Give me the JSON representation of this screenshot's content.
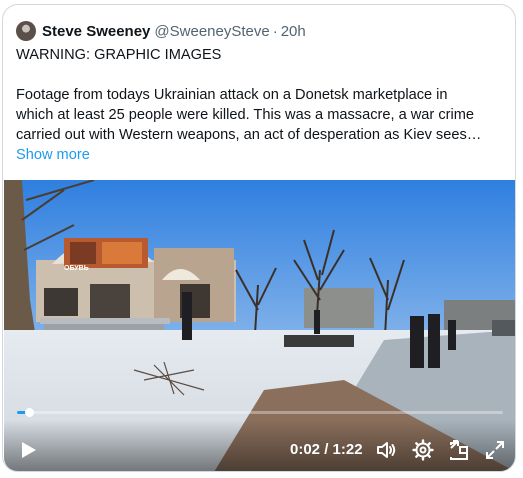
{
  "tweet": {
    "author_name": "Steve Sweeney",
    "handle": "@SweeneySteve",
    "separator": "·",
    "time": "20h",
    "warning": "WARNING: GRAPHIC IMAGES",
    "body_lines": [
      "Footage from todays Ukrainian attack on a Donetsk marketplace in",
      "which at least 25 people were killed. This was a massacre, a war crime",
      "carried out with Western weapons, an act of desperation as Kiev sees…"
    ],
    "show_more": "Show more"
  },
  "video": {
    "current_time": "0:02",
    "duration": "1:22",
    "time_separator": "/",
    "progress_fraction": 0.024,
    "storefront_sign": "ОБУВЬ",
    "icons": {
      "play": "play-icon",
      "volume": "volume-icon",
      "settings": "gear-icon",
      "pip": "picture-in-picture-icon",
      "fullscreen": "fullscreen-icon"
    },
    "accent_color": "#1d9bf0"
  }
}
